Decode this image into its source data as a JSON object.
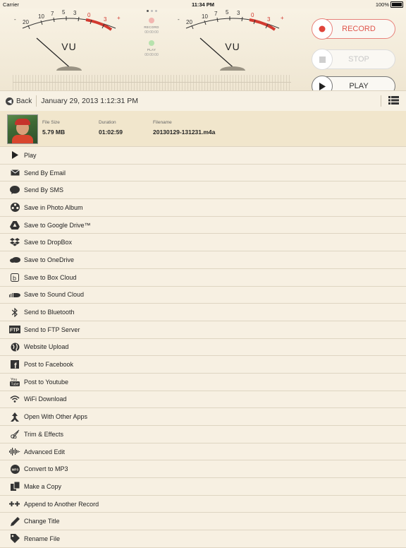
{
  "status": {
    "carrier": "Carrier",
    "time": "11:34 PM",
    "battery": "100%"
  },
  "meters": {
    "left": {
      "label": "VU",
      "ticks": [
        "20",
        "10",
        "7",
        "5",
        "3",
        "0",
        "3"
      ],
      "minus": "-",
      "plus": "+"
    },
    "right": {
      "label": "VU",
      "ticks": [
        "20",
        "10",
        "7",
        "5",
        "3",
        "0",
        "3"
      ],
      "minus": "-",
      "plus": "+"
    }
  },
  "mid": {
    "record_label": "RECORD",
    "record_time": "00:00:00",
    "play_label": "PLAY",
    "play_time": "00:00:00"
  },
  "controls": {
    "record": "RECORD",
    "stop": "STOP",
    "play": "PLAY"
  },
  "nav": {
    "back": "Back",
    "title": "January 29, 2013 1:12:31 PM"
  },
  "file": {
    "size_label": "File Size",
    "size": "5.79 MB",
    "duration_label": "Duration",
    "duration": "01:02:59",
    "filename_label": "Filename",
    "filename": "20130129-131231.m4a"
  },
  "actions": [
    {
      "label": "Play",
      "icon": "play-icon"
    },
    {
      "label": "Send By Email",
      "icon": "email-icon"
    },
    {
      "label": "Send By SMS",
      "icon": "sms-icon"
    },
    {
      "label": "Save in Photo Album",
      "icon": "film-reel-icon"
    },
    {
      "label": "Save to Google Drive™",
      "icon": "google-drive-icon"
    },
    {
      "label": "Save to DropBox",
      "icon": "dropbox-icon"
    },
    {
      "label": "Save to OneDrive",
      "icon": "onedrive-icon"
    },
    {
      "label": "Save to Box Cloud",
      "icon": "box-icon"
    },
    {
      "label": "Save to Sound Cloud",
      "icon": "soundcloud-icon"
    },
    {
      "label": "Send to Bluetooth",
      "icon": "bluetooth-icon"
    },
    {
      "label": "Send to FTP Server",
      "icon": "ftp-icon"
    },
    {
      "label": "Website Upload",
      "icon": "globe-icon"
    },
    {
      "label": "Post to Facebook",
      "icon": "facebook-icon"
    },
    {
      "label": "Post to Youtube",
      "icon": "youtube-icon"
    },
    {
      "label": "WiFi Download",
      "icon": "wifi-icon"
    },
    {
      "label": "Open With Other Apps",
      "icon": "share-icon"
    },
    {
      "label": "Trim & Effects",
      "icon": "scissors-icon"
    },
    {
      "label": "Advanced Edit",
      "icon": "waveform-icon"
    },
    {
      "label": "Convert to MP3",
      "icon": "mp3-icon"
    },
    {
      "label": "Make a Copy",
      "icon": "copy-icon"
    },
    {
      "label": "Append to Another Record",
      "icon": "append-icon"
    },
    {
      "label": "Change Title",
      "icon": "pencil-icon"
    },
    {
      "label": "Rename File",
      "icon": "tag-icon"
    }
  ],
  "colors": {
    "accent_red": "#e0564c",
    "background": "#f7f0e2",
    "info_bg": "#f1e6cc"
  }
}
